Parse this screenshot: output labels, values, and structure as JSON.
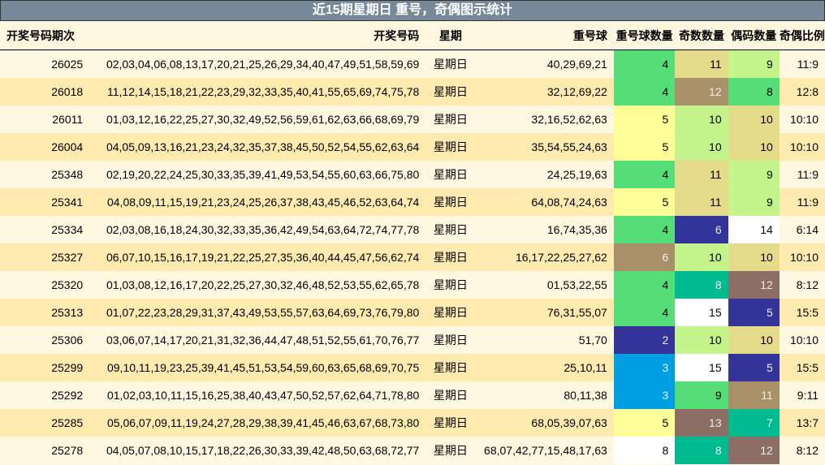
{
  "title": "近15期星期日 重号，奇偶图示统计",
  "headers": [
    "开奖号码期次",
    "开奖号码",
    "星期",
    "重号球",
    "重号球数量",
    "奇数数量",
    "偶码数量",
    "奇偶比例"
  ],
  "colors": {
    "title_bg": "#778899",
    "row_light": "#fff8e1",
    "row_dark": "#ffeab0"
  },
  "rows": [
    {
      "period": "26025",
      "numbers": "02,03,04,06,08,13,17,20,21,25,26,29,34,40,47,49,51,58,59,69",
      "weekday": "星期日",
      "repeats": "40,29,69,21",
      "repeat_count": "4",
      "odd": "11",
      "even": "9",
      "ratio": "11:9",
      "colors": [
        "#55dd77",
        "#e3da8a",
        "#c6f48c"
      ]
    },
    {
      "period": "26018",
      "numbers": "11,12,14,15,18,21,22,23,29,32,33,35,40,41,55,65,69,74,75,78",
      "weekday": "星期日",
      "repeats": "32,12,69,22",
      "repeat_count": "4",
      "odd": "12",
      "even": "8",
      "ratio": "12:8",
      "colors": [
        "#55dd77",
        "#a89068",
        "#55dd77"
      ]
    },
    {
      "period": "26011",
      "numbers": "01,03,12,16,22,25,27,30,32,49,52,56,59,61,62,63,66,68,69,79",
      "weekday": "星期日",
      "repeats": "32,16,52,62,63",
      "repeat_count": "5",
      "odd": "10",
      "even": "10",
      "ratio": "10:10",
      "colors": [
        "#ffff99",
        "#c6f48c",
        "#e3da8a"
      ]
    },
    {
      "period": "26004",
      "numbers": "04,05,09,13,16,21,23,24,32,35,37,38,45,50,52,54,55,62,63,64",
      "weekday": "星期日",
      "repeats": "35,54,55,24,63",
      "repeat_count": "5",
      "odd": "10",
      "even": "10",
      "ratio": "10:10",
      "colors": [
        "#ffff99",
        "#c6f48c",
        "#e3da8a"
      ]
    },
    {
      "period": "25348",
      "numbers": "02,19,20,22,24,25,30,33,35,39,41,49,53,54,55,60,63,66,75,80",
      "weekday": "星期日",
      "repeats": "24,25,19,63",
      "repeat_count": "4",
      "odd": "11",
      "even": "9",
      "ratio": "11:9",
      "colors": [
        "#55dd77",
        "#e3da8a",
        "#c6f48c"
      ]
    },
    {
      "period": "25341",
      "numbers": "04,08,09,11,15,19,21,23,24,25,26,37,38,43,45,46,52,63,64,74",
      "weekday": "星期日",
      "repeats": "64,08,74,24,63",
      "repeat_count": "5",
      "odd": "11",
      "even": "9",
      "ratio": "11:9",
      "colors": [
        "#ffff99",
        "#e3da8a",
        "#c6f48c"
      ]
    },
    {
      "period": "25334",
      "numbers": "02,03,08,16,18,24,30,32,33,35,36,42,49,54,63,64,72,74,77,78",
      "weekday": "星期日",
      "repeats": "16,74,35,36",
      "repeat_count": "4",
      "odd": "6",
      "even": "14",
      "ratio": "6:14",
      "colors": [
        "#55dd77",
        "#333399",
        "#ffffff"
      ]
    },
    {
      "period": "25327",
      "numbers": "06,07,10,15,16,17,19,21,22,25,27,35,36,40,44,45,47,56,62,74",
      "weekday": "星期日",
      "repeats": "16,17,22,25,27,62",
      "repeat_count": "6",
      "odd": "10",
      "even": "10",
      "ratio": "10:10",
      "colors": [
        "#a89068",
        "#c6f48c",
        "#e3da8a"
      ]
    },
    {
      "period": "25320",
      "numbers": "01,03,08,12,16,17,20,22,25,27,30,32,46,48,52,53,55,62,65,78",
      "weekday": "星期日",
      "repeats": "01,53,22,55",
      "repeat_count": "4",
      "odd": "8",
      "even": "12",
      "ratio": "8:12",
      "colors": [
        "#55dd77",
        "#00bb8f",
        "#8c6e66"
      ]
    },
    {
      "period": "25313",
      "numbers": "01,07,22,23,28,29,31,37,43,49,53,55,57,63,64,69,73,76,79,80",
      "weekday": "星期日",
      "repeats": "76,31,55,07",
      "repeat_count": "4",
      "odd": "15",
      "even": "5",
      "ratio": "15:5",
      "colors": [
        "#55dd77",
        "#ffffff",
        "#333399"
      ]
    },
    {
      "period": "25306",
      "numbers": "03,06,07,14,17,20,21,31,32,36,44,47,48,51,52,55,61,70,76,77",
      "weekday": "星期日",
      "repeats": "51,70",
      "repeat_count": "2",
      "odd": "10",
      "even": "10",
      "ratio": "10:10",
      "colors": [
        "#333399",
        "#c6f48c",
        "#e3da8a"
      ]
    },
    {
      "period": "25299",
      "numbers": "09,10,11,19,23,25,39,41,45,51,53,54,59,60,63,65,68,69,70,75",
      "weekday": "星期日",
      "repeats": "25,10,11",
      "repeat_count": "3",
      "odd": "15",
      "even": "5",
      "ratio": "15:5",
      "colors": [
        "#009fe3",
        "#ffffff",
        "#333399"
      ]
    },
    {
      "period": "25292",
      "numbers": "01,02,03,10,11,15,16,25,38,40,43,47,50,52,57,62,64,71,78,80",
      "weekday": "星期日",
      "repeats": "80,11,38",
      "repeat_count": "3",
      "odd": "9",
      "even": "11",
      "ratio": "9:11",
      "colors": [
        "#009fe3",
        "#55dd77",
        "#a89068"
      ]
    },
    {
      "period": "25285",
      "numbers": "05,06,07,09,11,19,24,27,28,29,38,39,41,45,46,63,67,68,73,80",
      "weekday": "星期日",
      "repeats": "68,05,39,07,63",
      "repeat_count": "5",
      "odd": "13",
      "even": "7",
      "ratio": "13:7",
      "colors": [
        "#ffff99",
        "#8c6e66",
        "#00bb8f"
      ]
    },
    {
      "period": "25278",
      "numbers": "04,05,07,08,10,15,17,18,22,26,30,33,39,42,48,50,63,68,72,77",
      "weekday": "星期日",
      "repeats": "68,07,42,77,15,48,17,63",
      "repeat_count": "8",
      "odd": "8",
      "even": "12",
      "ratio": "8:12",
      "colors": [
        "#ffffff",
        "#00bb8f",
        "#8c6e66"
      ]
    }
  ]
}
